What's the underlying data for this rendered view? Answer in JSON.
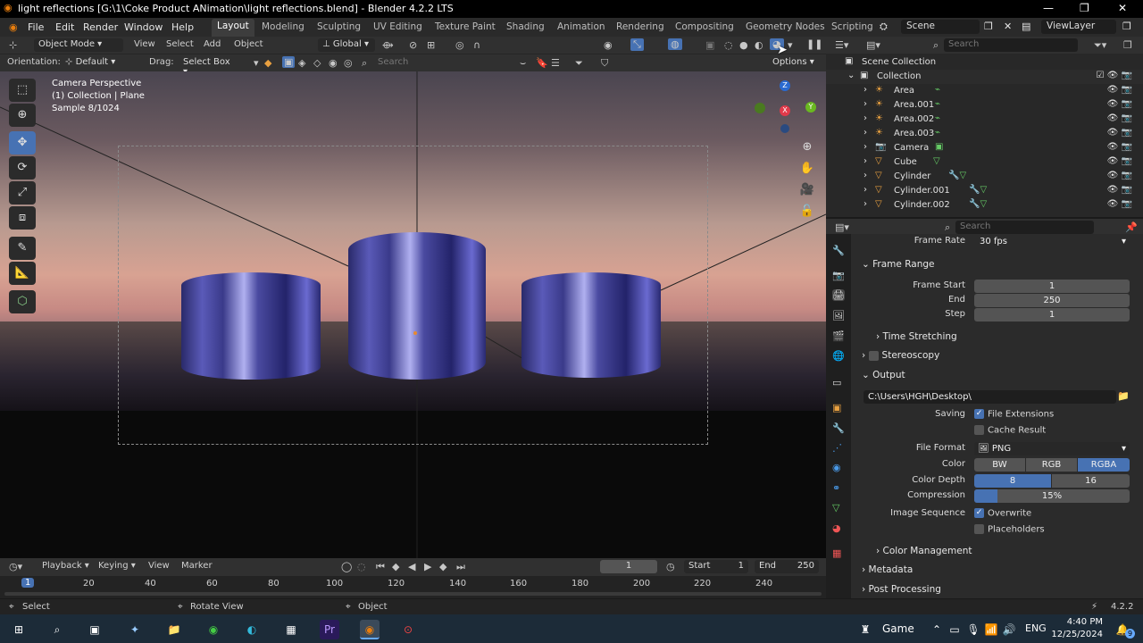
{
  "window": {
    "title": "light reflections [G:\\1\\Coke Product ANimation\\light reflections.blend] - Blender 4.2.2 LTS",
    "minimize": "—",
    "maximize": "❐",
    "close": "✕"
  },
  "menu": [
    "File",
    "Edit",
    "Render",
    "Window",
    "Help"
  ],
  "workspaces": [
    "Layout",
    "Modeling",
    "Sculpting",
    "UV Editing",
    "Texture Paint",
    "Shading",
    "Animation",
    "Rendering",
    "Compositing",
    "Geometry Nodes",
    "Scripting"
  ],
  "active_workspace": "Layout",
  "scene": {
    "name": "Scene",
    "view_layer": "ViewLayer"
  },
  "viewport_header": {
    "mode": "Object Mode",
    "menus": [
      "View",
      "Select",
      "Add",
      "Object"
    ],
    "transform": "Global",
    "orientation_label": "Orientation:",
    "orientation_value": "Default",
    "drag_label": "Drag:",
    "drag_value": "Select Box",
    "search_placeholder": "Search",
    "options_label": "Options"
  },
  "viewport": {
    "line1": "Camera Perspective",
    "line2": "(1) Collection | Plane",
    "line3": "Sample 8/1024",
    "gizmo_z": "Z",
    "gizmo_x": "X",
    "gizmo_y": "Y"
  },
  "outliner": {
    "search_placeholder": "Search",
    "root": "Scene Collection",
    "collection": "Collection",
    "items": [
      {
        "name": "Area",
        "type": "light"
      },
      {
        "name": "Area.001",
        "type": "light"
      },
      {
        "name": "Area.002",
        "type": "light"
      },
      {
        "name": "Area.003",
        "type": "light"
      },
      {
        "name": "Camera",
        "type": "camera"
      },
      {
        "name": "Cube",
        "type": "mesh"
      },
      {
        "name": "Cylinder",
        "type": "mesh"
      },
      {
        "name": "Cylinder.001",
        "type": "mesh"
      },
      {
        "name": "Cylinder.002",
        "type": "mesh"
      }
    ]
  },
  "properties": {
    "search_placeholder": "Search",
    "frame_rate_label": "Frame Rate",
    "frame_rate_value": "30 fps",
    "frame_range_title": "Frame Range",
    "frame_start_label": "Frame Start",
    "frame_start_value": "1",
    "end_label": "End",
    "end_value": "250",
    "step_label": "Step",
    "step_value": "1",
    "time_stretching": "Time Stretching",
    "stereoscopy": "Stereoscopy",
    "output_title": "Output",
    "output_path": "C:\\Users\\HGH\\Desktop\\",
    "saving_label": "Saving",
    "file_extensions": "File Extensions",
    "cache_result": "Cache Result",
    "file_format_label": "File Format",
    "file_format_value": "PNG",
    "color_label": "Color",
    "color_options": [
      "BW",
      "RGB",
      "RGBA"
    ],
    "color_selected": "RGBA",
    "color_depth_label": "Color Depth",
    "color_depth_options": [
      "8",
      "16"
    ],
    "color_depth_selected": "8",
    "compression_label": "Compression",
    "compression_value": "15%",
    "compression_fraction": 0.15,
    "image_sequence_label": "Image Sequence",
    "overwrite": "Overwrite",
    "placeholders": "Placeholders",
    "color_management": "Color Management",
    "metadata": "Metadata",
    "post_processing": "Post Processing"
  },
  "timeline": {
    "menus": [
      "Playback",
      "Keying",
      "View",
      "Marker"
    ],
    "current_frame": "1",
    "start_label": "Start",
    "start_value": "1",
    "end_label": "End",
    "end_value": "250",
    "ticks": [
      "1",
      "20",
      "40",
      "60",
      "80",
      "100",
      "120",
      "140",
      "160",
      "180",
      "200",
      "220",
      "240"
    ]
  },
  "statusbar": {
    "select": "Select",
    "rotate_view": "Rotate View",
    "object": "Object",
    "version": "4.2.2"
  },
  "taskbar": {
    "game": "Game",
    "lang": "ENG",
    "time": "4:40 PM",
    "date": "12/25/2024",
    "notif": "9"
  }
}
